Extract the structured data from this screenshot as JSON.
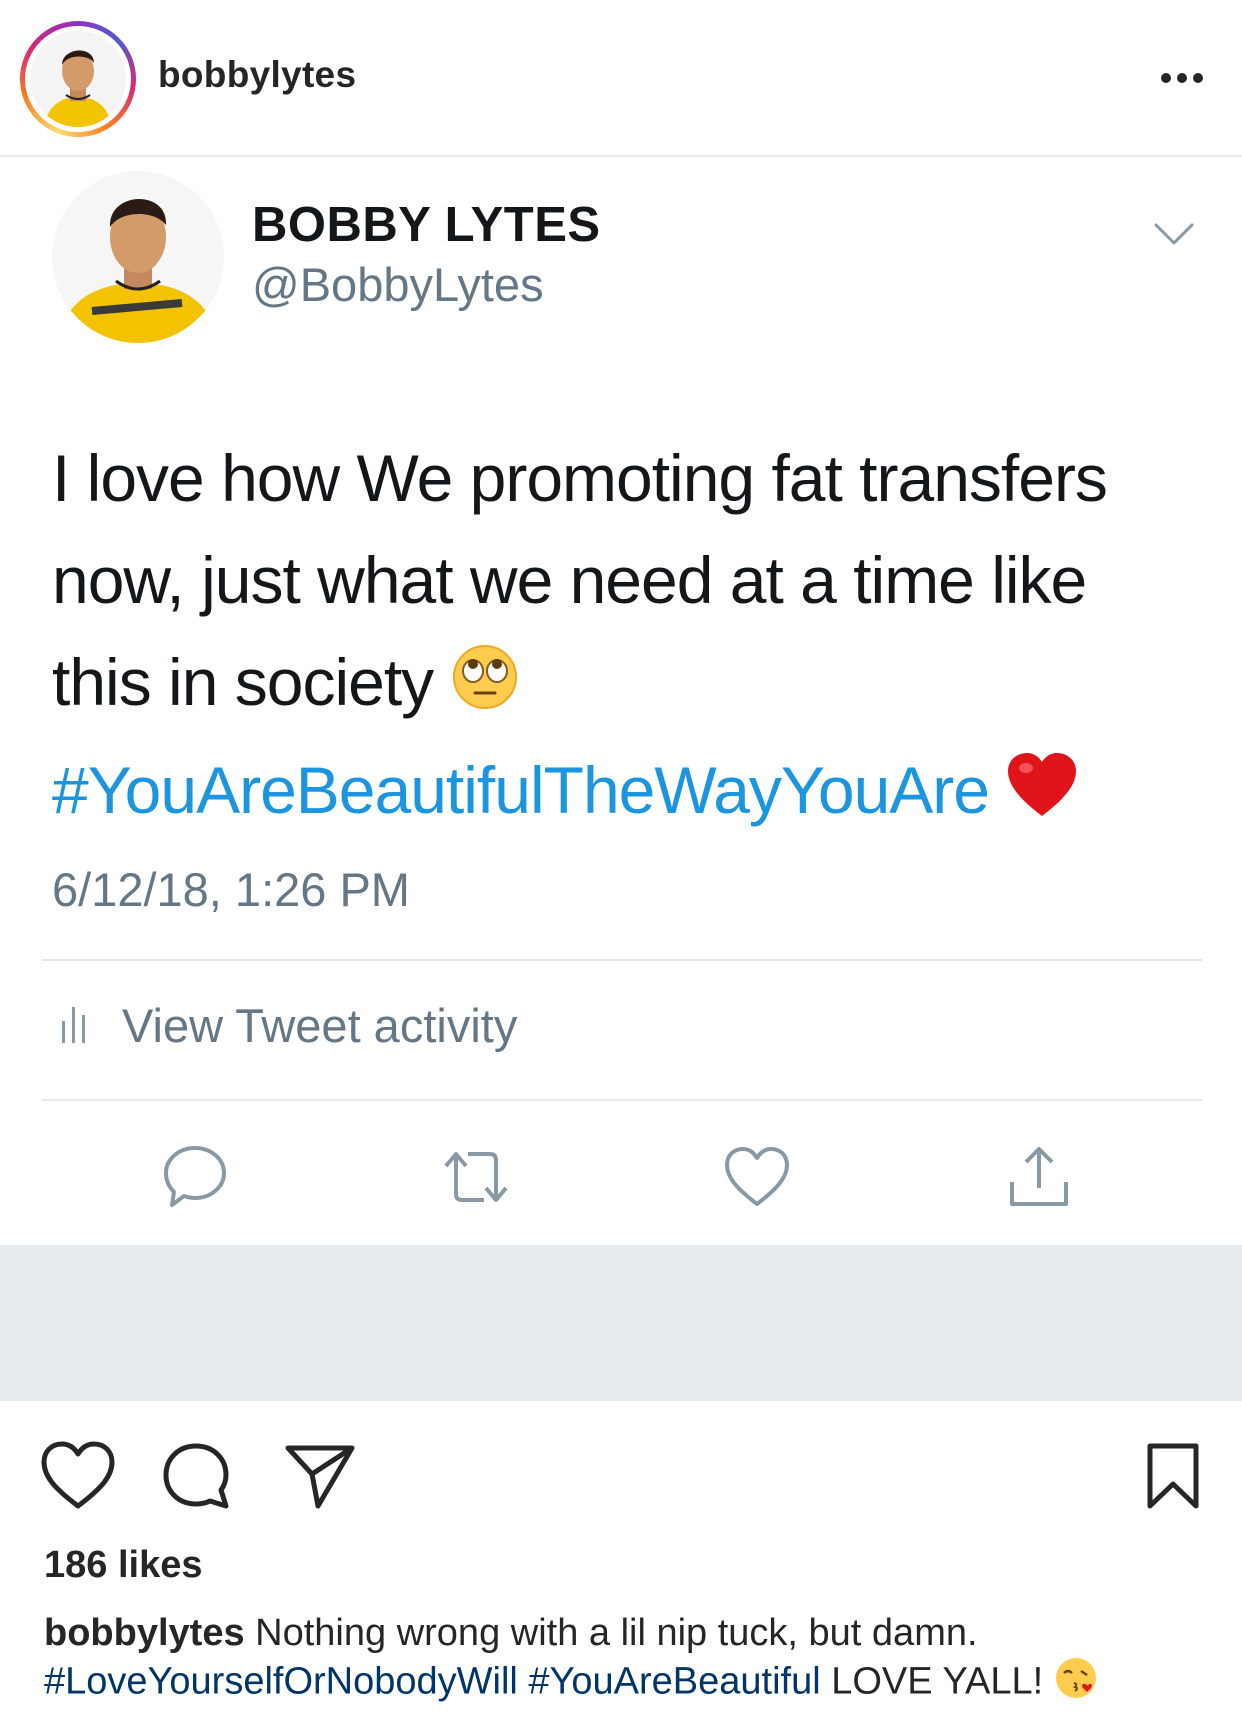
{
  "instagram": {
    "username": "bobbylytes",
    "likes": "186 likes",
    "caption": {
      "username": "bobbylytes",
      "text": " Nothing wrong with a lil nip tuck, but damn.",
      "hashtag1": "#LoveYourselfOrNobodyWill",
      "hashtag2": "#YouAreBeautiful",
      "tail": " LOVE YALL! "
    },
    "icons": [
      "avatar",
      "more-icon",
      "heart-icon",
      "comment-icon",
      "share-icon",
      "bookmark-icon",
      "kiss-emoji-icon"
    ]
  },
  "tweet": {
    "display_name": "BOBBY LYTES",
    "handle": "@BobbyLytes",
    "text_line1": "I love how We promoting fat transfers",
    "text_line2": "now, just what we need at a time like",
    "text_line3": "this in society ",
    "hashtag": "#YouAreBeautifulTheWayYouAre",
    "timestamp": "6/12/18, 1:26 PM",
    "activity_label": "View Tweet activity",
    "icons": [
      "chevron-down-icon",
      "eye-roll-emoji-icon",
      "red-heart-emoji-icon",
      "bar-chart-icon",
      "reply-icon",
      "retweet-icon",
      "like-icon",
      "share-icon"
    ]
  },
  "colors": {
    "twitter_blue": "#1b95e0",
    "twitter_gray": "#657786",
    "ig_tag_blue": "#003569",
    "gap_gray": "#e6ecf0"
  }
}
